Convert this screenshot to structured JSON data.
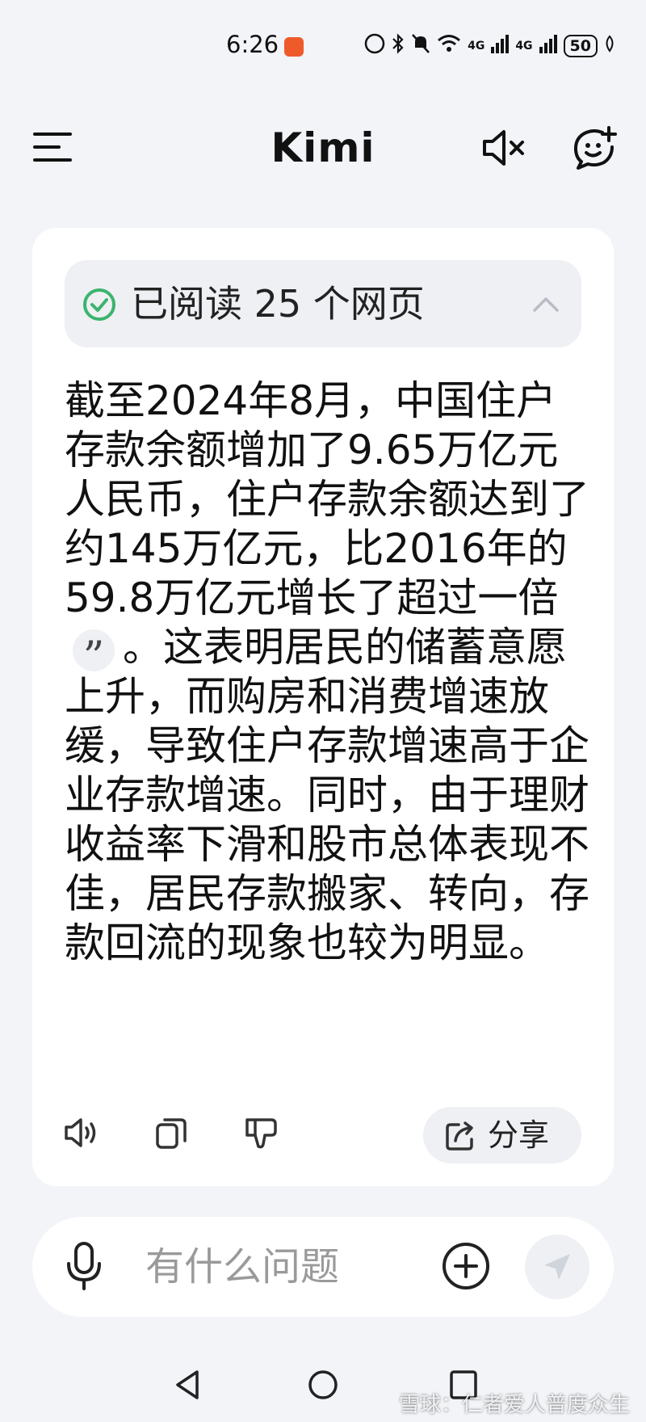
{
  "status_bar": {
    "time": "6:26",
    "network_1": "4G",
    "network_2": "4G",
    "battery": "50"
  },
  "header": {
    "title": "Kimi"
  },
  "answer": {
    "sources_label": "已阅读 25 个网页",
    "text_part1": "截至2024年8月，中国住户存款余额增加了9.65万亿元人民币，住户存款余额达到了约145万亿元，比2016年的59.8万亿元增长了超过一倍",
    "citation_mark": "”",
    "text_part2": "。这表明居民的储蓄意愿上升，而购房和消费增速放缓，导致住户存款增速高于企业存款增速。同时，由于理财收益率下滑和股市总体表现不佳，居民存款搬家、转向，存款回流的现象也较为明显。",
    "share_label": "分享"
  },
  "input": {
    "placeholder": "有什么问题"
  },
  "watermark": "雪球：仁者爱人普度众生",
  "colors": {
    "background": "#f2f4f8",
    "card": "#ffffff",
    "pill": "#eef0f4",
    "check_green": "#3bb46e",
    "placeholder": "#9a9a9a"
  },
  "icons": [
    "menu-icon",
    "mute-icon",
    "new-chat-icon",
    "check-circle-icon",
    "chevron-up-icon",
    "speaker-icon",
    "copy-icon",
    "thumbs-down-icon",
    "share-icon",
    "mic-icon",
    "plus-icon",
    "send-icon"
  ]
}
